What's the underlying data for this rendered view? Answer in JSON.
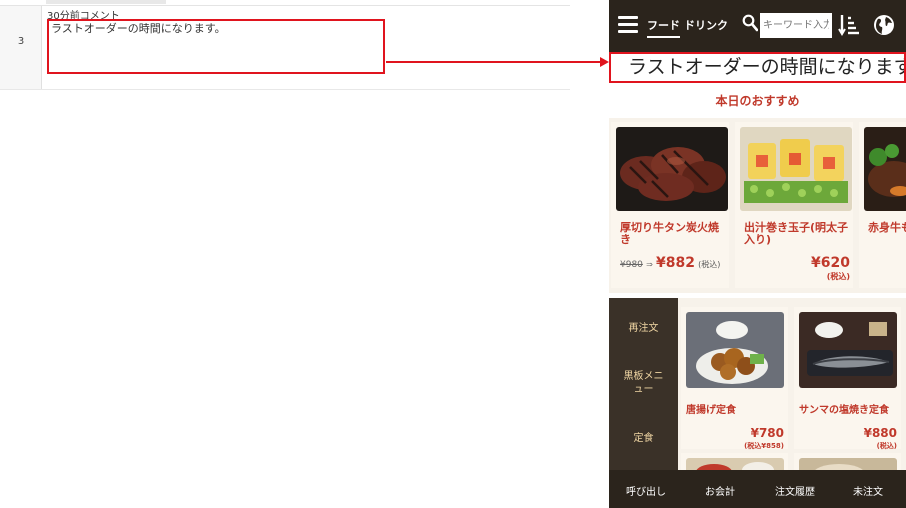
{
  "sheet": {
    "row_number": "3",
    "column_title": "30分前コメント",
    "cell_text": "ラストオーダーの時間になります。"
  },
  "header": {
    "tabs": [
      "フード",
      "ドリンク"
    ],
    "search_placeholder": "キーワード入力",
    "icons": [
      "hamburger-icon",
      "search-icon",
      "sort-icon",
      "globe-icon"
    ]
  },
  "notice": {
    "text": "ラストオーダーの時間になります。"
  },
  "recommend": {
    "title": "本日のおすすめ",
    "items": [
      {
        "name": "厚切り牛タン炭火焼き",
        "old_price": "¥980",
        "arrow": "⇒",
        "price": "¥882",
        "tax": "(税込)"
      },
      {
        "name": "出汁巻き玉子(明太子入り)",
        "price": "¥620",
        "tax": "(税込)"
      },
      {
        "name": "赤身牛もル"
      }
    ]
  },
  "side_menu": {
    "items": [
      "再注文",
      "黒板メニュー",
      "定食"
    ]
  },
  "menu": {
    "items": [
      {
        "name": "唐揚げ定食",
        "price": "¥780",
        "tax": "(税込¥858)"
      },
      {
        "name": "サンマの塩焼き定食",
        "price": "¥880",
        "tax": "(税込)"
      }
    ]
  },
  "bottom_bar": {
    "items": [
      "呼び出し",
      "お会計",
      "注文履歴",
      "未注文"
    ]
  },
  "colors": {
    "accent_red": "#c0392b",
    "highlight_red": "#e0141e",
    "dark_bar": "#2b241c",
    "side_menu_bg": "#3a3128",
    "side_menu_text": "#f0d6a4"
  }
}
